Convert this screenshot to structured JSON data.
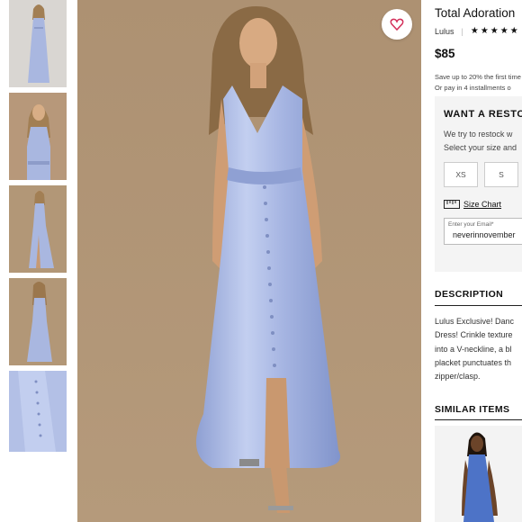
{
  "product": {
    "title": "Total Adoration",
    "brand": "Lulus",
    "stars": "★★★★★",
    "price": "$85",
    "promo_line1": "Save up to 20% the first time",
    "promo_line2": "Or pay in 4 installments o"
  },
  "restock": {
    "heading": "WANT A RESTO",
    "text_line1": "We try to restock w",
    "text_line2": "Select your size and",
    "sizes": [
      "XS",
      "S"
    ],
    "size_chart_label": "Size Chart",
    "email_placeholder": "Enter your Email*",
    "email_value": "neverinnovember"
  },
  "description": {
    "heading": "DESCRIPTION",
    "lines": [
      "Lulus Exclusive! Danc",
      "Dress! Crinkle texture",
      "into a V-neckline, a bl",
      "placket punctuates th",
      "zipper/clasp."
    ]
  },
  "similar": {
    "heading": "SIMILAR ITEMS"
  },
  "colors": {
    "dress": "#a9b7e0",
    "background": "#b29777",
    "accent": "#d32f5a"
  }
}
